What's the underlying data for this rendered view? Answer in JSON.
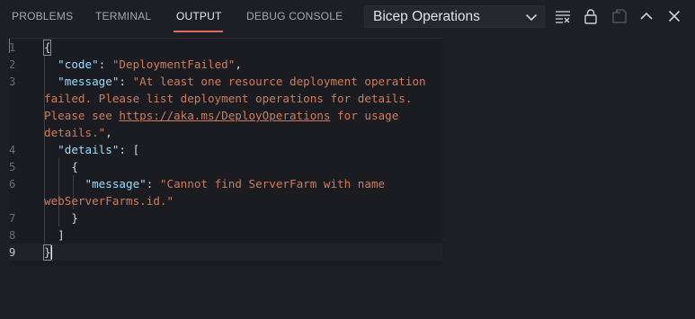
{
  "tabs": [
    {
      "label": "PROBLEMS",
      "active": false
    },
    {
      "label": "TERMINAL",
      "active": false
    },
    {
      "label": "OUTPUT",
      "active": true
    },
    {
      "label": "DEBUG CONSOLE",
      "active": false
    }
  ],
  "output_channel": {
    "selected": "Bicep Operations"
  },
  "toolbar": {
    "icons": [
      "clear-output-icon",
      "lock-icon",
      "open-in-editor-icon",
      "maximize-panel-icon",
      "close-panel-icon"
    ]
  },
  "editor": {
    "line_numbers": [
      "1",
      "2",
      "3",
      "4",
      "5",
      "6",
      "7",
      "8",
      "9"
    ],
    "active_line": "9",
    "lines": {
      "l1": {
        "p": "{"
      },
      "l2": {
        "k": "\"code\"",
        "colon": ": ",
        "s": "\"DeploymentFailed\"",
        "end": ","
      },
      "l3": {
        "k": "\"message\"",
        "colon": ": ",
        "s1": "\"At least one resource deployment operation",
        "s2": "failed. Please list deployment operations for details.",
        "s3a": "Please see ",
        "link": "https://aka.ms/DeployOperations",
        "s3b": " for usage",
        "s4": "details.\"",
        "end": ","
      },
      "l4": {
        "k": "\"details\"",
        "colon": ": ["
      },
      "l5": {
        "p": "{"
      },
      "l6": {
        "k": "\"message\"",
        "colon": ": ",
        "s1": "\"Cannot find ServerFarm with name",
        "s2": "webServerFarms.id.\""
      },
      "l7": {
        "p": "}"
      },
      "l8": {
        "p": "]"
      },
      "l9": {
        "p": "}"
      }
    }
  },
  "colors": {
    "background": "#1e1f26",
    "editor_background": "#1b1c22",
    "active_tab_underline": "#e06c5a",
    "json_key": "#9cdcfe",
    "json_string": "#ce7b5d"
  }
}
